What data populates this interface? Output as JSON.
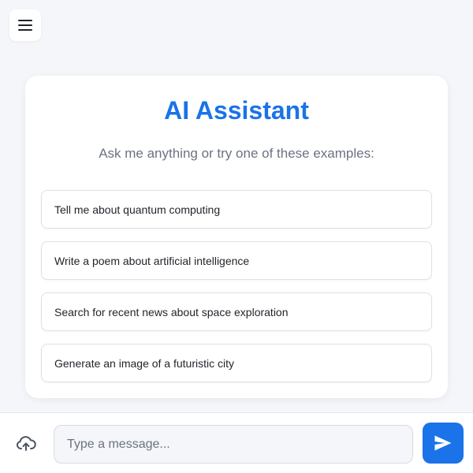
{
  "header": {
    "menu_icon": "hamburger-menu-icon"
  },
  "welcome": {
    "title": "AI Assistant",
    "subtitle": "Ask me anything or try one of these examples:",
    "examples": [
      "Tell me about quantum computing",
      "Write a poem about artificial intelligence",
      "Search for recent news about space exploration",
      "Generate an image of a futuristic city"
    ]
  },
  "composer": {
    "upload_icon": "cloud-upload-icon",
    "placeholder": "Type a message...",
    "value": "",
    "send_icon": "send-icon"
  },
  "colors": {
    "accent": "#1a73e8",
    "background": "#f4f6f9",
    "card": "#ffffff",
    "subtitle_text": "#6b7280",
    "border": "#dde1e6"
  }
}
